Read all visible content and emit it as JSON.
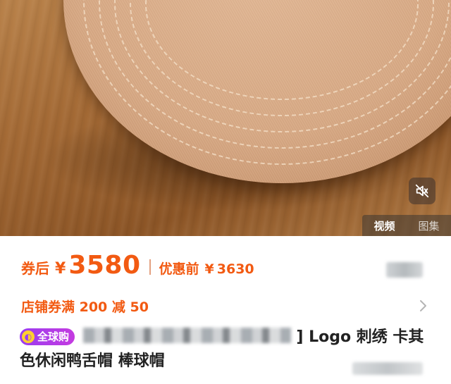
{
  "media": {
    "tabs": [
      {
        "label": "视频",
        "active": true
      },
      {
        "label": "图集",
        "active": false
      }
    ],
    "mute_icon": "muted-speaker-icon"
  },
  "price": {
    "coupon_label": "券后",
    "currency": "¥",
    "amount": "3580",
    "original_label": "优惠前",
    "original_currency": "¥",
    "original_amount": "3630",
    "accent_color": "#f25a12"
  },
  "coupon": {
    "text": "店铺券满 200 减 50",
    "chevron_icon": "chevron-right-icon"
  },
  "title": {
    "badge": "全球购",
    "text_part": "] Logo 刺绣 卡其色休闲鸭舌帽 棒球帽"
  }
}
